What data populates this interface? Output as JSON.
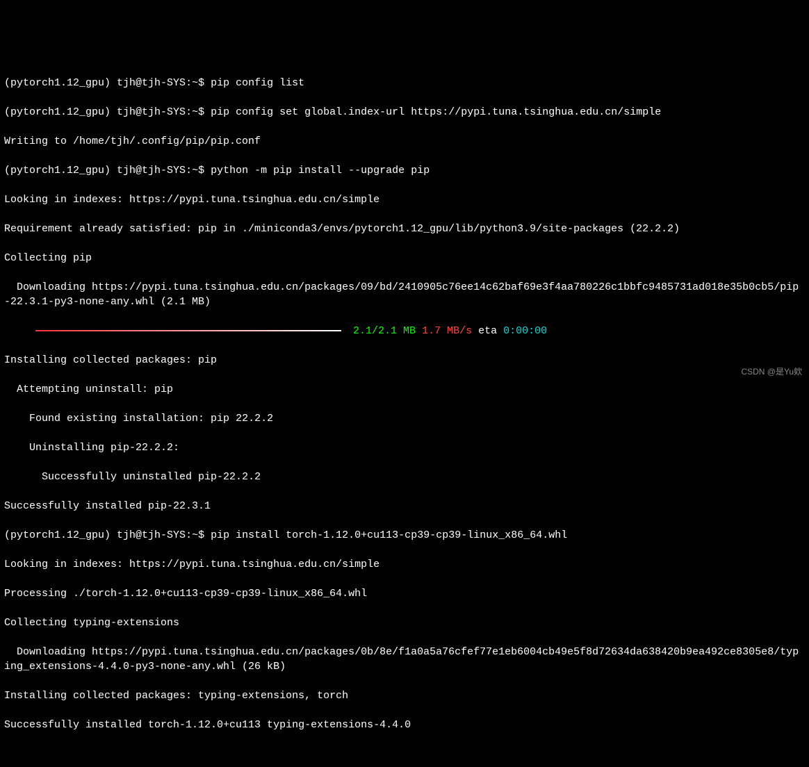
{
  "prompt": {
    "env": "(pytorch1.12_gpu)",
    "userhost": "tjh@tjh-SYS",
    "cwd": "~",
    "sep": ":",
    "sym": "$"
  },
  "commands": {
    "c1": "pip config list",
    "c2": "pip config set global.index-url https://pypi.tuna.tsinghua.edu.cn/simple",
    "c3": "python -m pip install --upgrade pip",
    "c4": "pip install torch-1.12.0+cu113-cp39-cp39-linux_x86_64.whl"
  },
  "output": {
    "o1": "Writing to /home/tjh/.config/pip/pip.conf",
    "o2": "Looking in indexes: https://pypi.tuna.tsinghua.edu.cn/simple",
    "o3": "Requirement already satisfied: pip in ./miniconda3/envs/pytorch1.12_gpu/lib/python3.9/site-packages (22.2.2)",
    "o4": "Collecting pip",
    "o5": "  Downloading https://pypi.tuna.tsinghua.edu.cn/packages/09/bd/2410905c76ee14c62baf69e3f4aa780226c1bbfc9485731ad018e35b0cb5/pip-22.3.1-py3-none-any.whl (2.1 MB)",
    "o6": "Installing collected packages: pip",
    "o7": "  Attempting uninstall: pip",
    "o8": "    Found existing installation: pip 22.2.2",
    "o9": "    Uninstalling pip-22.2.2:",
    "o10": "      Successfully uninstalled pip-22.2.2",
    "o11": "Successfully installed pip-22.3.1",
    "o12": "Looking in indexes: https://pypi.tuna.tsinghua.edu.cn/simple",
    "o13": "Processing ./torch-1.12.0+cu113-cp39-cp39-linux_x86_64.whl",
    "o14": "Collecting typing-extensions",
    "o15": "  Downloading https://pypi.tuna.tsinghua.edu.cn/packages/0b/8e/f1a0a5a76cfef77e1eb6004cb49e5f8d72634da638420b9ea492ce8305e8/typing_extensions-4.4.0-py3-none-any.whl (26 kB)",
    "o16": "Installing collected packages: typing-extensions, torch",
    "o17": "Successfully installed torch-1.12.0+cu113 typing-extensions-4.4.0"
  },
  "progress": {
    "done": "2.1/2.1 MB",
    "speed": "1.7 MB/s",
    "eta_label": "eta",
    "eta_value": "0:00:00",
    "indent": "     "
  },
  "watermark": "CSDN @是Yu欸"
}
